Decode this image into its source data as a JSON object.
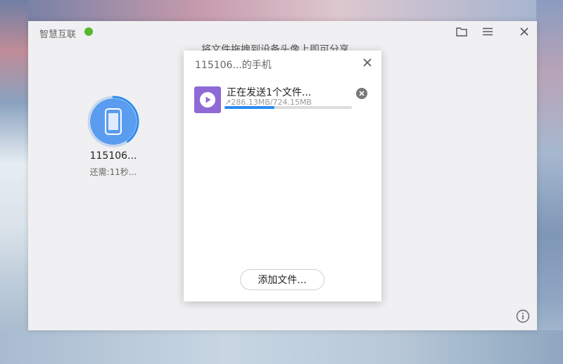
{
  "app": {
    "title": "智慧互联",
    "status_color": "#55b82b",
    "toolbar": {
      "folder_icon": "folder-icon",
      "menu_icon": "menu-icon",
      "close_icon": "close-icon"
    },
    "hint": "将文件拖拽到设备头像上即可分享"
  },
  "device": {
    "name": "115106...",
    "remaining": "还需:11秒...",
    "icon": "phone-icon",
    "progress": 0.4,
    "ring_color": "#2a8cf0",
    "avatar_color": "#5a9cf0"
  },
  "dialog": {
    "title": "115106...的手机",
    "close_icon": "close-icon",
    "file": {
      "status": "正在发送1个文件...",
      "progress_text": "↗286.13MB/724.15MB",
      "progress": 0.395,
      "icon": "video-play-icon",
      "icon_color": "#8f6ad6",
      "cancel_icon": "cancel-icon"
    },
    "add_file_label": "添加文件..."
  },
  "footer": {
    "info_icon": "info-icon"
  }
}
